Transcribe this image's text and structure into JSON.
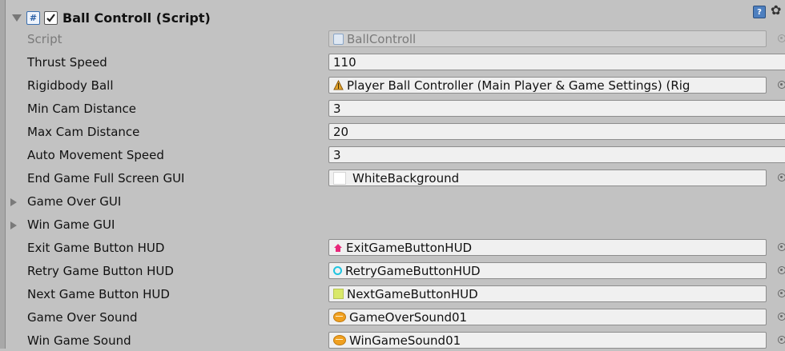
{
  "component": {
    "title": "Ball Controll (Script)",
    "enabled": true
  },
  "fields": [
    {
      "id": "script",
      "label": "Script",
      "type": "object",
      "value": "BallControll",
      "icon": "script-icon",
      "disabled": true
    },
    {
      "id": "thrust-speed",
      "label": "Thrust Speed",
      "type": "number",
      "value": "110"
    },
    {
      "id": "rigidbody-ball",
      "label": "Rigidbody Ball",
      "type": "object",
      "value": "Player Ball Controller (Main Player & Game Settings) (Rig",
      "icon": "rigidbody-icon"
    },
    {
      "id": "min-cam-distance",
      "label": "Min Cam Distance",
      "type": "number",
      "value": "3"
    },
    {
      "id": "max-cam-distance",
      "label": "Max Cam Distance",
      "type": "number",
      "value": "20"
    },
    {
      "id": "auto-movement-speed",
      "label": "Auto Movement Speed",
      "type": "number",
      "value": "3"
    },
    {
      "id": "end-game-full-screen-gui",
      "label": "End Game Full Screen GUI",
      "type": "object",
      "value": "WhiteBackground",
      "icon": "texture-icon"
    },
    {
      "id": "game-over-gui",
      "label": "Game Over GUI",
      "type": "foldout"
    },
    {
      "id": "win-game-gui",
      "label": "Win Game GUI",
      "type": "foldout"
    },
    {
      "id": "exit-game-button-hud",
      "label": "Exit Game Button HUD",
      "type": "object",
      "value": "ExitGameButtonHUD",
      "icon": "house-icon"
    },
    {
      "id": "retry-game-button-hud",
      "label": "Retry Game Button HUD",
      "type": "object",
      "value": "RetryGameButtonHUD",
      "icon": "retry-icon"
    },
    {
      "id": "next-game-button-hud",
      "label": "Next Game Button HUD",
      "type": "object",
      "value": "NextGameButtonHUD",
      "icon": "next-icon"
    },
    {
      "id": "game-over-sound",
      "label": "Game Over Sound",
      "type": "object",
      "value": "GameOverSound01",
      "icon": "audio-clip-icon"
    },
    {
      "id": "win-game-sound",
      "label": "Win Game Sound",
      "type": "object",
      "value": "WinGameSound01",
      "icon": "audio-clip-icon"
    }
  ],
  "colors": {
    "panel": "#c2c2c2",
    "field": "#f0f0f0",
    "exit_icon": "#e8287a",
    "retry_icon": "#1fc4e0",
    "sound_icon": "#f0a020"
  }
}
